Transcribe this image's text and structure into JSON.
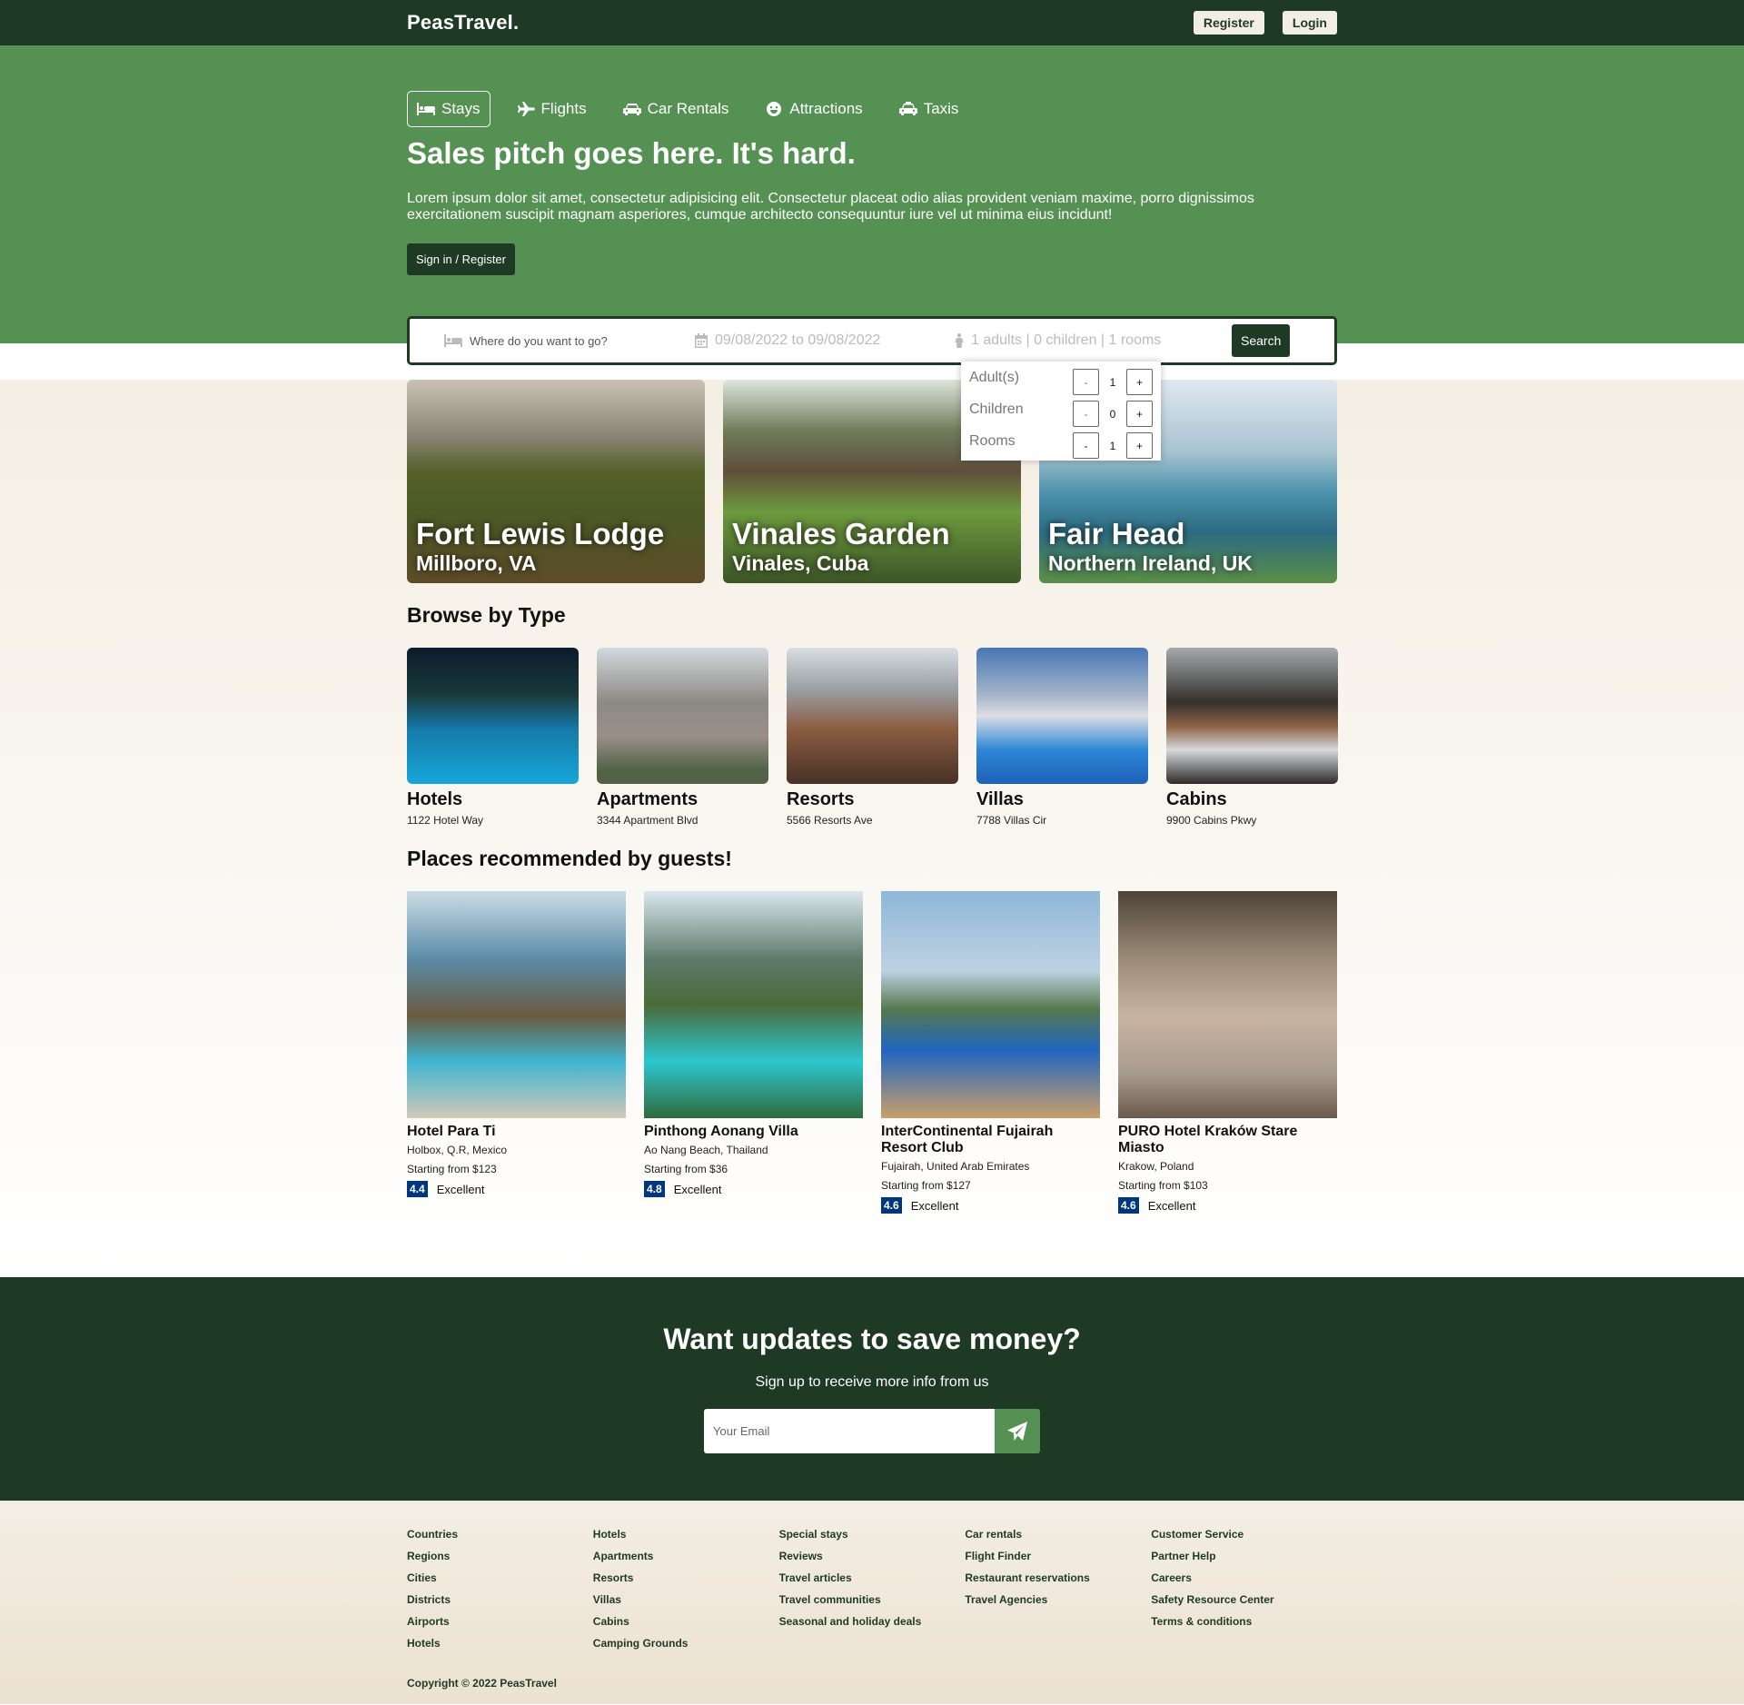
{
  "header": {
    "logo": "PeasTravel.",
    "register": "Register",
    "login": "Login"
  },
  "hero": {
    "tabs": [
      {
        "label": "Stays",
        "icon": "bed-icon"
      },
      {
        "label": "Flights",
        "icon": "plane-icon"
      },
      {
        "label": "Car Rentals",
        "icon": "car-icon"
      },
      {
        "label": "Attractions",
        "icon": "smile-icon"
      },
      {
        "label": "Taxis",
        "icon": "taxi-icon"
      }
    ],
    "title": "Sales pitch goes here. It's hard.",
    "description": "Lorem ipsum dolor sit amet, consectetur adipisicing elit. Consectetur placeat odio alias provident veniam maxime, porro dignissimos exercitationem suscipit magnam asperiores, cumque architecto consequuntur iure vel ut minima eius incidunt!",
    "cta": "Sign in / Register"
  },
  "search": {
    "destination_placeholder": "Where do you want to go?",
    "dates": "09/08/2022 to 09/08/2022",
    "guests": "1 adults | 0 children | 1 rooms",
    "button": "Search"
  },
  "guest_options": [
    {
      "label": "Adult(s)",
      "value": "1"
    },
    {
      "label": "Children",
      "value": "0"
    },
    {
      "label": "Rooms",
      "value": "1"
    }
  ],
  "featured": [
    {
      "title": "Fort Lewis Lodge",
      "location": "Millboro, VA"
    },
    {
      "title": "Vinales Garden",
      "location": "Vinales, Cuba"
    },
    {
      "title": "Fair Head",
      "location": "Northern Ireland, UK"
    }
  ],
  "browse": {
    "heading": "Browse by Type",
    "items": [
      {
        "name": "Hotels",
        "address": "1122 Hotel Way"
      },
      {
        "name": "Apartments",
        "address": "3344 Apartment Blvd"
      },
      {
        "name": "Resorts",
        "address": "5566 Resorts Ave"
      },
      {
        "name": "Villas",
        "address": "7788 Villas Cir"
      },
      {
        "name": "Cabins",
        "address": "9900 Cabins Pkwy"
      }
    ]
  },
  "recommended": {
    "heading": "Places recommended by guests!",
    "items": [
      {
        "name": "Hotel Para Ti",
        "location": "Holbox, Q.R, Mexico",
        "price": "Starting from $123",
        "score": "4.4",
        "rating": "Excellent"
      },
      {
        "name": "Pinthong Aonang Villa",
        "location": "Ao Nang Beach, Thailand",
        "price": "Starting from $36",
        "score": "4.8",
        "rating": "Excellent"
      },
      {
        "name": "InterContinental Fujairah Resort Club",
        "location": "Fujairah, United Arab Emirates",
        "price": "Starting from $127",
        "score": "4.6",
        "rating": "Excellent"
      },
      {
        "name": "PURO Hotel Kraków Stare Miasto",
        "location": "Krakow, Poland",
        "price": "Starting from $103",
        "score": "4.6",
        "rating": "Excellent"
      }
    ]
  },
  "newsletter": {
    "title": "Want updates to save money?",
    "subtitle": "Sign up to receive more info from us",
    "placeholder": "Your Email"
  },
  "footer": {
    "columns": [
      [
        "Countries",
        "Regions",
        "Cities",
        "Districts",
        "Airports",
        "Hotels"
      ],
      [
        "Hotels",
        "Apartments",
        "Resorts",
        "Villas",
        "Cabins",
        "Camping Grounds"
      ],
      [
        "Special stays",
        "Reviews",
        "Travel articles",
        "Travel communities",
        "Seasonal and holiday deals"
      ],
      [
        "Car rentals",
        "Flight Finder",
        "Restaurant reservations",
        "Travel Agencies"
      ],
      [
        "Customer Service",
        "Partner Help",
        "Careers",
        "Safety Resource Center",
        "Terms & conditions"
      ]
    ],
    "copyright": "Copyright © 2022 PeasTravel"
  },
  "colors": {
    "dark_green": "#1e3a24",
    "green": "#559153",
    "cream": "#f3eee4",
    "score_blue": "#003580"
  }
}
